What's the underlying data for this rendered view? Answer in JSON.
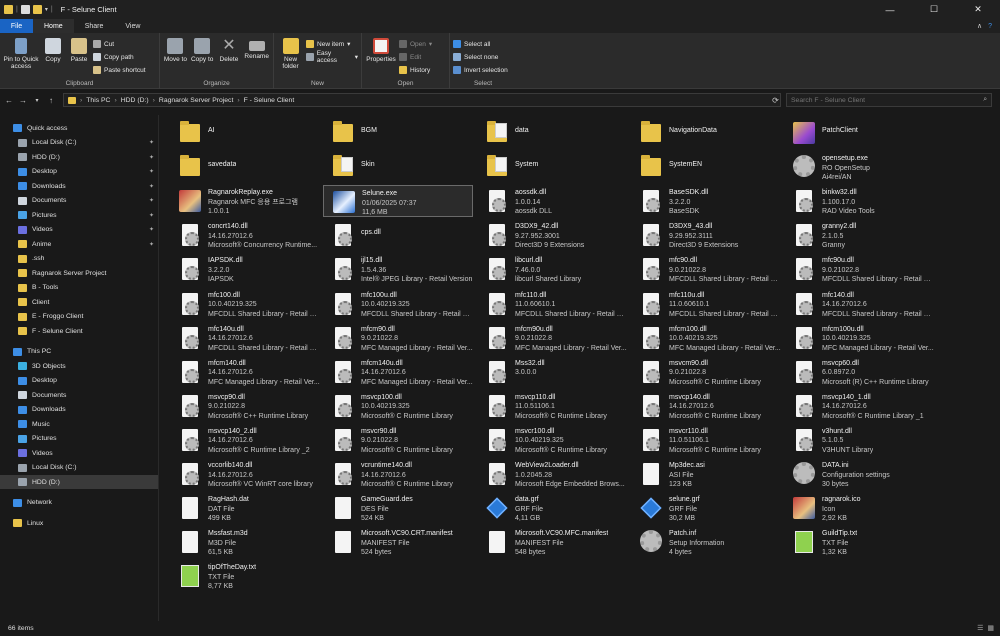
{
  "window": {
    "title": "F - Selune Client",
    "controls": [
      "—",
      "☐",
      "✕"
    ]
  },
  "tabs": [
    {
      "label": "File",
      "kind": "file"
    },
    {
      "label": "Home",
      "kind": "active"
    },
    {
      "label": "Share",
      "kind": ""
    },
    {
      "label": "View",
      "kind": ""
    }
  ],
  "ribbon": {
    "clipboard": {
      "label": "Clipboard",
      "pin": "Pin to Quick access",
      "copy": "Copy",
      "paste": "Paste",
      "cut": "Cut",
      "copy_path": "Copy path",
      "paste_shortcut": "Paste shortcut"
    },
    "organize": {
      "label": "Organize",
      "move_to": "Move to",
      "copy_to": "Copy to",
      "delete": "Delete",
      "rename": "Rename"
    },
    "new": {
      "label": "New",
      "new_folder": "New folder",
      "new_item": "New item",
      "easy_access": "Easy access"
    },
    "open": {
      "label": "Open",
      "properties": "Properties",
      "open": "Open",
      "edit": "Edit",
      "history": "History"
    },
    "select": {
      "label": "Select",
      "select_all": "Select all",
      "select_none": "Select none",
      "invert": "Invert selection"
    }
  },
  "address": {
    "path": [
      "This PC",
      "HDD (D:)",
      "Ragnarok Server Project",
      "F - Selune Client"
    ],
    "search_placeholder": "Search F - Selune Client"
  },
  "sidebar": [
    {
      "label": "Quick access",
      "color": "#3d8ee6",
      "indent": 0,
      "pinned": false,
      "selected": false
    },
    {
      "label": "Local Disk (C:)",
      "color": "#9aa3ad",
      "indent": 1,
      "pinned": true,
      "selected": false
    },
    {
      "label": "HDD (D:)",
      "color": "#9aa3ad",
      "indent": 1,
      "pinned": true,
      "selected": false
    },
    {
      "label": "Desktop",
      "color": "#3d8ee6",
      "indent": 1,
      "pinned": true,
      "selected": false
    },
    {
      "label": "Downloads",
      "color": "#3d8ee6",
      "indent": 1,
      "pinned": true,
      "selected": false
    },
    {
      "label": "Documents",
      "color": "#cfd6de",
      "indent": 1,
      "pinned": true,
      "selected": false
    },
    {
      "label": "Pictures",
      "color": "#4aa3e6",
      "indent": 1,
      "pinned": true,
      "selected": false
    },
    {
      "label": "Videos",
      "color": "#6b6fe0",
      "indent": 1,
      "pinned": true,
      "selected": false
    },
    {
      "label": "Anime",
      "color": "#e8c34a",
      "indent": 1,
      "pinned": true,
      "selected": false
    },
    {
      "label": ".ssh",
      "color": "#e8c34a",
      "indent": 1,
      "pinned": false,
      "selected": false
    },
    {
      "label": "Ragnarok Server Project",
      "color": "#e8c34a",
      "indent": 1,
      "pinned": false,
      "selected": false
    },
    {
      "label": "B - Tools",
      "color": "#e8c34a",
      "indent": 1,
      "pinned": false,
      "selected": false
    },
    {
      "label": "Client",
      "color": "#e8c34a",
      "indent": 1,
      "pinned": false,
      "selected": false
    },
    {
      "label": "E - Froggo Client",
      "color": "#e8c34a",
      "indent": 1,
      "pinned": false,
      "selected": false
    },
    {
      "label": "F - Selune Client",
      "color": "#e8c34a",
      "indent": 1,
      "pinned": false,
      "selected": false
    },
    {
      "label": "",
      "color": "",
      "indent": 0,
      "pinned": false,
      "selected": false
    },
    {
      "label": "This PC",
      "color": "#3d8ee6",
      "indent": 0,
      "pinned": false,
      "selected": false
    },
    {
      "label": "3D Objects",
      "color": "#3bb0e0",
      "indent": 1,
      "pinned": false,
      "selected": false
    },
    {
      "label": "Desktop",
      "color": "#3d8ee6",
      "indent": 1,
      "pinned": false,
      "selected": false
    },
    {
      "label": "Documents",
      "color": "#cfd6de",
      "indent": 1,
      "pinned": false,
      "selected": false
    },
    {
      "label": "Downloads",
      "color": "#3d8ee6",
      "indent": 1,
      "pinned": false,
      "selected": false
    },
    {
      "label": "Music",
      "color": "#3d8ee6",
      "indent": 1,
      "pinned": false,
      "selected": false
    },
    {
      "label": "Pictures",
      "color": "#4aa3e6",
      "indent": 1,
      "pinned": false,
      "selected": false
    },
    {
      "label": "Videos",
      "color": "#6b6fe0",
      "indent": 1,
      "pinned": false,
      "selected": false
    },
    {
      "label": "Local Disk (C:)",
      "color": "#9aa3ad",
      "indent": 1,
      "pinned": false,
      "selected": false
    },
    {
      "label": "HDD (D:)",
      "color": "#9aa3ad",
      "indent": 1,
      "pinned": false,
      "selected": true
    },
    {
      "label": "",
      "color": "",
      "indent": 0,
      "pinned": false,
      "selected": false
    },
    {
      "label": "Network",
      "color": "#3d8ee6",
      "indent": 0,
      "pinned": false,
      "selected": false
    },
    {
      "label": "",
      "color": "",
      "indent": 0,
      "pinned": false,
      "selected": false
    },
    {
      "label": "Linux",
      "color": "#e8c34a",
      "indent": 0,
      "pinned": false,
      "selected": false
    }
  ],
  "files": [
    {
      "name": "AI",
      "l2": "",
      "l3": "",
      "icon": "folder"
    },
    {
      "name": "BGM",
      "l2": "",
      "l3": "",
      "icon": "folder"
    },
    {
      "name": "data",
      "l2": "",
      "l3": "",
      "icon": "folder-doc"
    },
    {
      "name": "NavigationData",
      "l2": "",
      "l3": "",
      "icon": "folder"
    },
    {
      "name": "PatchClient",
      "l2": "",
      "l3": "",
      "icon": "img-purple"
    },
    {
      "name": "savedata",
      "l2": "",
      "l3": "",
      "icon": "folder"
    },
    {
      "name": "Skin",
      "l2": "",
      "l3": "",
      "icon": "folder-doc"
    },
    {
      "name": "System",
      "l2": "",
      "l3": "",
      "icon": "folder-doc"
    },
    {
      "name": "SystemEN",
      "l2": "",
      "l3": "",
      "icon": "folder"
    },
    {
      "name": "opensetup.exe",
      "l2": "RO OpenSetup",
      "l3": "Ai4rei/AN",
      "icon": "gear"
    },
    {
      "name": "RagnarokReplay.exe",
      "l2": "Ragnarok MFC 응용 프로그램",
      "l3": "1.0.0.1",
      "icon": "img-red"
    },
    {
      "name": "Selune.exe",
      "l2": "01/06/2025 07:37",
      "l3": "11,6 MB",
      "icon": "img-blue",
      "selected": true
    },
    {
      "name": "aossdk.dll",
      "l2": "1.0.0.14",
      "l3": "aossdk DLL",
      "icon": "dll"
    },
    {
      "name": "BaseSDK.dll",
      "l2": "3.2.2.0",
      "l3": "BaseSDK",
      "icon": "dll"
    },
    {
      "name": "binkw32.dll",
      "l2": "1.100.17.0",
      "l3": "RAD Video Tools",
      "icon": "dll"
    },
    {
      "name": "concrt140.dll",
      "l2": "14.16.27012.6",
      "l3": "Microsoft® Concurrency Runtime...",
      "icon": "dll"
    },
    {
      "name": "cps.dll",
      "l2": "",
      "l3": "",
      "icon": "dll"
    },
    {
      "name": "D3DX9_42.dll",
      "l2": "9.27.952.3001",
      "l3": "Direct3D 9 Extensions",
      "icon": "dll"
    },
    {
      "name": "D3DX9_43.dll",
      "l2": "9.29.952.3111",
      "l3": "Direct3D 9 Extensions",
      "icon": "dll"
    },
    {
      "name": "granny2.dll",
      "l2": "2.1.0.5",
      "l3": "Granny",
      "icon": "dll"
    },
    {
      "name": "IAPSDK.dll",
      "l2": "3.2.2.0",
      "l3": "IAPSDK",
      "icon": "dll"
    },
    {
      "name": "ijl15.dll",
      "l2": "1.5.4.36",
      "l3": "Intel® JPEG Library - Retail Version",
      "icon": "dll"
    },
    {
      "name": "libcurl.dll",
      "l2": "7.46.0.0",
      "l3": "libcurl Shared Library",
      "icon": "dll"
    },
    {
      "name": "mfc90.dll",
      "l2": "9.0.21022.8",
      "l3": "MFCDLL Shared Library - Retail Ve...",
      "icon": "dll"
    },
    {
      "name": "mfc90u.dll",
      "l2": "9.0.21022.8",
      "l3": "MFCDLL Shared Library - Retail Ve...",
      "icon": "dll"
    },
    {
      "name": "mfc100.dll",
      "l2": "10.0.40219.325",
      "l3": "MFCDLL Shared Library - Retail Ve...",
      "icon": "dll"
    },
    {
      "name": "mfc100u.dll",
      "l2": "10.0.40219.325",
      "l3": "MFCDLL Shared Library - Retail Ve...",
      "icon": "dll"
    },
    {
      "name": "mfc110.dll",
      "l2": "11.0.60610.1",
      "l3": "MFCDLL Shared Library - Retail Ve...",
      "icon": "dll"
    },
    {
      "name": "mfc110u.dll",
      "l2": "11.0.60610.1",
      "l3": "MFCDLL Shared Library - Retail Ve...",
      "icon": "dll"
    },
    {
      "name": "mfc140.dll",
      "l2": "14.16.27012.6",
      "l3": "MFCDLL Shared Library - Retail Ve...",
      "icon": "dll"
    },
    {
      "name": "mfc140u.dll",
      "l2": "14.16.27012.6",
      "l3": "MFCDLL Shared Library - Retail Ve...",
      "icon": "dll"
    },
    {
      "name": "mfcm90.dll",
      "l2": "9.0.21022.8",
      "l3": "MFC Managed Library - Retail Ver...",
      "icon": "dll"
    },
    {
      "name": "mfcm90u.dll",
      "l2": "9.0.21022.8",
      "l3": "MFC Managed Library - Retail Ver...",
      "icon": "dll"
    },
    {
      "name": "mfcm100.dll",
      "l2": "10.0.40219.325",
      "l3": "MFC Managed Library - Retail Ver...",
      "icon": "dll"
    },
    {
      "name": "mfcm100u.dll",
      "l2": "10.0.40219.325",
      "l3": "MFC Managed Library - Retail Ver...",
      "icon": "dll"
    },
    {
      "name": "mfcm140.dll",
      "l2": "14.16.27012.6",
      "l3": "MFC Managed Library - Retail Ver...",
      "icon": "dll"
    },
    {
      "name": "mfcm140u.dll",
      "l2": "14.16.27012.6",
      "l3": "MFC Managed Library - Retail Ver...",
      "icon": "dll"
    },
    {
      "name": "Mss32.dll",
      "l2": "3.0.0.0",
      "l3": "",
      "icon": "dll"
    },
    {
      "name": "msvcm90.dll",
      "l2": "9.0.21022.8",
      "l3": "Microsoft® C Runtime Library",
      "icon": "dll"
    },
    {
      "name": "msvcp60.dll",
      "l2": "6.0.8972.0",
      "l3": "Microsoft (R) C++ Runtime Library",
      "icon": "dll"
    },
    {
      "name": "msvcp90.dll",
      "l2": "9.0.21022.8",
      "l3": "Microsoft® C++ Runtime Library",
      "icon": "dll"
    },
    {
      "name": "msvcp100.dll",
      "l2": "10.0.40219.325",
      "l3": "Microsoft® C Runtime Library",
      "icon": "dll"
    },
    {
      "name": "msvcp110.dll",
      "l2": "11.0.51106.1",
      "l3": "Microsoft® C Runtime Library",
      "icon": "dll"
    },
    {
      "name": "msvcp140.dll",
      "l2": "14.16.27012.6",
      "l3": "Microsoft® C Runtime Library",
      "icon": "dll"
    },
    {
      "name": "msvcp140_1.dll",
      "l2": "14.16.27012.6",
      "l3": "Microsoft® C Runtime Library _1",
      "icon": "dll"
    },
    {
      "name": "msvcp140_2.dll",
      "l2": "14.16.27012.6",
      "l3": "Microsoft® C Runtime Library _2",
      "icon": "dll"
    },
    {
      "name": "msvcr90.dll",
      "l2": "9.0.21022.8",
      "l3": "Microsoft® C Runtime Library",
      "icon": "dll"
    },
    {
      "name": "msvcr100.dll",
      "l2": "10.0.40219.325",
      "l3": "Microsoft® C Runtime Library",
      "icon": "dll"
    },
    {
      "name": "msvcr110.dll",
      "l2": "11.0.51106.1",
      "l3": "Microsoft® C Runtime Library",
      "icon": "dll"
    },
    {
      "name": "v3hunt.dll",
      "l2": "5.1.0.5",
      "l3": "V3HUNT Library",
      "icon": "dll"
    },
    {
      "name": "vccorlib140.dll",
      "l2": "14.16.27012.6",
      "l3": "Microsoft® VC WinRT core library",
      "icon": "dll"
    },
    {
      "name": "vcruntime140.dll",
      "l2": "14.16.27012.6",
      "l3": "Microsoft® C Runtime Library",
      "icon": "dll"
    },
    {
      "name": "WebView2Loader.dll",
      "l2": "1.0.2045.28",
      "l3": "Microsoft Edge Embedded Brows...",
      "icon": "dll"
    },
    {
      "name": "Mp3dec.asi",
      "l2": "ASI File",
      "l3": "123 KB",
      "icon": "doc"
    },
    {
      "name": "DATA.ini",
      "l2": "Configuration settings",
      "l3": "30 bytes",
      "icon": "gear"
    },
    {
      "name": "RagHash.dat",
      "l2": "DAT File",
      "l3": "499 KB",
      "icon": "doc"
    },
    {
      "name": "GameGuard.des",
      "l2": "DES File",
      "l3": "524 KB",
      "icon": "doc"
    },
    {
      "name": "data.grf",
      "l2": "GRF File",
      "l3": "4,11 GB",
      "icon": "cube"
    },
    {
      "name": "selune.grf",
      "l2": "GRF File",
      "l3": "30,2 MB",
      "icon": "cube"
    },
    {
      "name": "ragnarok.ico",
      "l2": "Icon",
      "l3": "2,92 KB",
      "icon": "img-red"
    },
    {
      "name": "Mssfast.m3d",
      "l2": "M3D File",
      "l3": "61,5 KB",
      "icon": "doc"
    },
    {
      "name": "Microsoft.VC90.CRT.manifest",
      "l2": "MANIFEST File",
      "l3": "524 bytes",
      "icon": "doc"
    },
    {
      "name": "Microsoft.VC90.MFC.manifest",
      "l2": "MANIFEST File",
      "l3": "548 bytes",
      "icon": "doc"
    },
    {
      "name": "Patch.inf",
      "l2": "Setup Information",
      "l3": "4 bytes",
      "icon": "gear"
    },
    {
      "name": "GuildTip.txt",
      "l2": "TXT File",
      "l3": "1,32 KB",
      "icon": "txt"
    },
    {
      "name": "tipOfTheDay.txt",
      "l2": "TXT File",
      "l3": "8,77 KB",
      "icon": "txt"
    }
  ],
  "status": {
    "items": "66 items"
  }
}
